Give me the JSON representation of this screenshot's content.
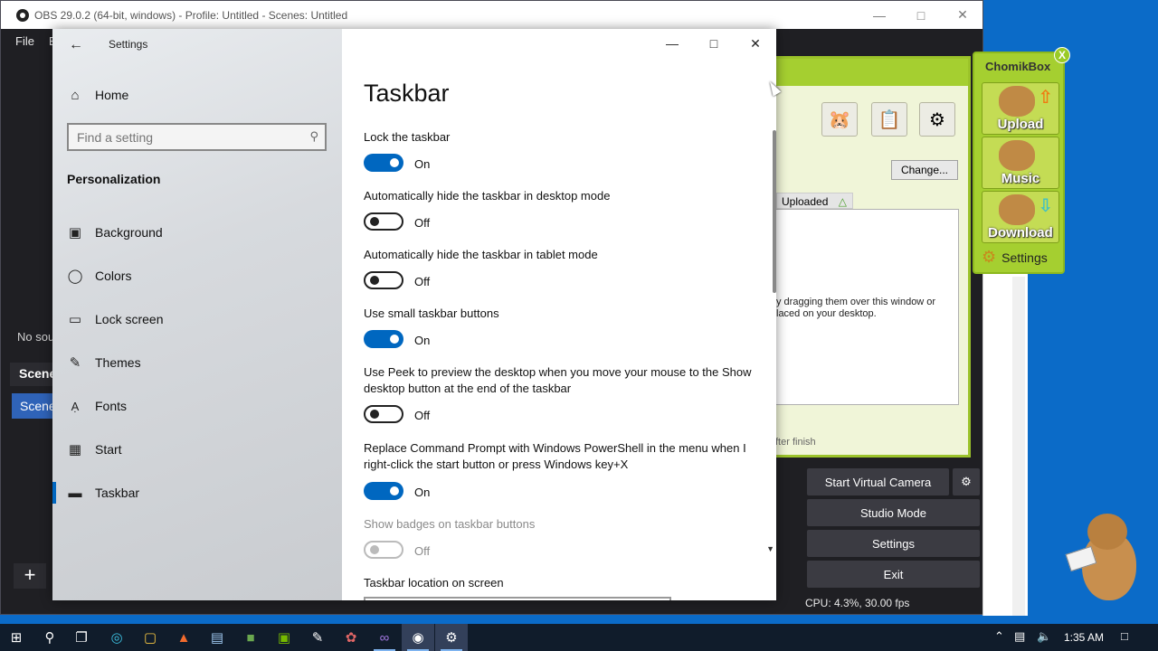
{
  "obs": {
    "title": "OBS 29.0.2 (64-bit, windows) - Profile: Untitled - Scenes: Untitled",
    "menu": [
      "File",
      "E"
    ],
    "no_sources_text": "No sou",
    "scenes_header": "Scene",
    "scene_item": "Scene",
    "buttons": {
      "start_virtual_camera": "Start Virtual Camera",
      "studio_mode": "Studio Mode",
      "settings": "Settings",
      "exit": "Exit"
    },
    "status": "CPU: 4.3%, 30.00 fps"
  },
  "settings_window": {
    "app_title": "Settings",
    "nav": {
      "home": "Home",
      "search_placeholder": "Find a setting",
      "section": "Personalization",
      "items": [
        {
          "label": "Background",
          "icon": "image-icon"
        },
        {
          "label": "Colors",
          "icon": "palette-icon"
        },
        {
          "label": "Lock screen",
          "icon": "monitor-icon"
        },
        {
          "label": "Themes",
          "icon": "brush-icon"
        },
        {
          "label": "Fonts",
          "icon": "font-icon"
        },
        {
          "label": "Start",
          "icon": "start-grid-icon"
        },
        {
          "label": "Taskbar",
          "icon": "taskbar-icon",
          "selected": true
        }
      ]
    },
    "page_title": "Taskbar",
    "settings": [
      {
        "label": "Lock the taskbar",
        "state": "On",
        "enabled": true
      },
      {
        "label": "Automatically hide the taskbar in desktop mode",
        "state": "Off",
        "enabled": true
      },
      {
        "label": "Automatically hide the taskbar in tablet mode",
        "state": "Off",
        "enabled": true
      },
      {
        "label": "Use small taskbar buttons",
        "state": "On",
        "enabled": true
      },
      {
        "label": "Use Peek to preview the desktop when you move your mouse to the Show desktop button at the end of the taskbar",
        "state": "Off",
        "enabled": true
      },
      {
        "label": "Replace Command Prompt with Windows PowerShell in the menu when I right-click the start button or press Windows key+X",
        "state": "On",
        "enabled": true
      },
      {
        "label": "Show badges on taskbar buttons",
        "state": "Off",
        "enabled": false
      }
    ],
    "location_label": "Taskbar location on screen"
  },
  "chomikbox": {
    "title": "ChomikBox",
    "close_label": "X",
    "upload": "Upload",
    "music": "Music",
    "download": "Download",
    "settings": "Settings",
    "change_button": "Change...",
    "list_header": "Uploaded",
    "hint_line1": "y dragging them over this window or",
    "hint_line2": "laced on your desktop.",
    "after_finish": "fter finish"
  },
  "taskbar": {
    "time": "1:35 AM",
    "apps": [
      "start-icon",
      "search-icon",
      "task-view-icon",
      "edge-icon",
      "file-explorer-icon",
      "brave-icon",
      "notepad-icon",
      "minecraft-icon",
      "nvidia-icon",
      "paint-icon",
      "app-icon",
      "visual-studio-icon",
      "obs-icon",
      "settings-icon"
    ]
  }
}
